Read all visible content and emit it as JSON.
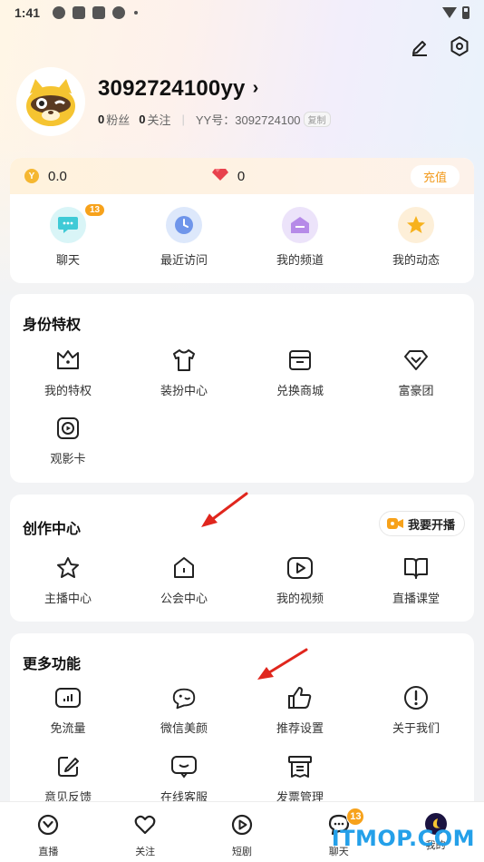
{
  "status_bar": {
    "time": "1:41"
  },
  "profile": {
    "username": "3092724100yy",
    "fans_count": "0",
    "fans_label": "粉丝",
    "follow_count": "0",
    "follow_label": "关注",
    "yy_id_label": "YY号：3092724100",
    "copy_label": "复制"
  },
  "wallet": {
    "coin_value": "0.0",
    "diamond_value": "0",
    "recharge_label": "充值"
  },
  "quick_items": [
    {
      "label": "聊天",
      "icon": "chat-bubble-icon",
      "badge": "13"
    },
    {
      "label": "最近访问",
      "icon": "clock-icon"
    },
    {
      "label": "我的频道",
      "icon": "channel-icon"
    },
    {
      "label": "我的动态",
      "icon": "star-icon"
    }
  ],
  "identity": {
    "title": "身份特权",
    "items": [
      {
        "label": "我的特权",
        "icon": "crown-icon"
      },
      {
        "label": "装扮中心",
        "icon": "tshirt-icon"
      },
      {
        "label": "兑换商城",
        "icon": "shop-icon"
      },
      {
        "label": "富豪团",
        "icon": "diamond-icon"
      },
      {
        "label": "观影卡",
        "icon": "play-card-icon"
      }
    ]
  },
  "creator": {
    "title": "创作中心",
    "live_button": "我要开播",
    "items": [
      {
        "label": "主播中心",
        "icon": "star-outline-icon"
      },
      {
        "label": "公会中心",
        "icon": "house-icon"
      },
      {
        "label": "我的视频",
        "icon": "video-icon"
      },
      {
        "label": "直播课堂",
        "icon": "book-icon"
      }
    ]
  },
  "more": {
    "title": "更多功能",
    "items": [
      {
        "label": "免流量",
        "icon": "data-card-icon"
      },
      {
        "label": "微信美颜",
        "icon": "beauty-icon"
      },
      {
        "label": "推荐设置",
        "icon": "thumbs-up-icon"
      },
      {
        "label": "关于我们",
        "icon": "info-icon"
      },
      {
        "label": "意见反馈",
        "icon": "edit-icon"
      },
      {
        "label": "在线客服",
        "icon": "customer-service-icon"
      },
      {
        "label": "发票管理",
        "icon": "invoice-icon"
      }
    ]
  },
  "tabbar": [
    {
      "label": "直播",
      "icon": "live-icon"
    },
    {
      "label": "关注",
      "icon": "heart-icon"
    },
    {
      "label": "短剧",
      "icon": "play-icon"
    },
    {
      "label": "聊天",
      "icon": "chat-icon",
      "badge": "13"
    },
    {
      "label": "我的",
      "icon": "me-avatar-icon"
    }
  ],
  "watermark": "ITMOP.COM",
  "colors": {
    "accent": "#f7a21b",
    "recharge": "#f29a1d",
    "watermark": "#24a0e9",
    "arrow": "#e0261d"
  }
}
